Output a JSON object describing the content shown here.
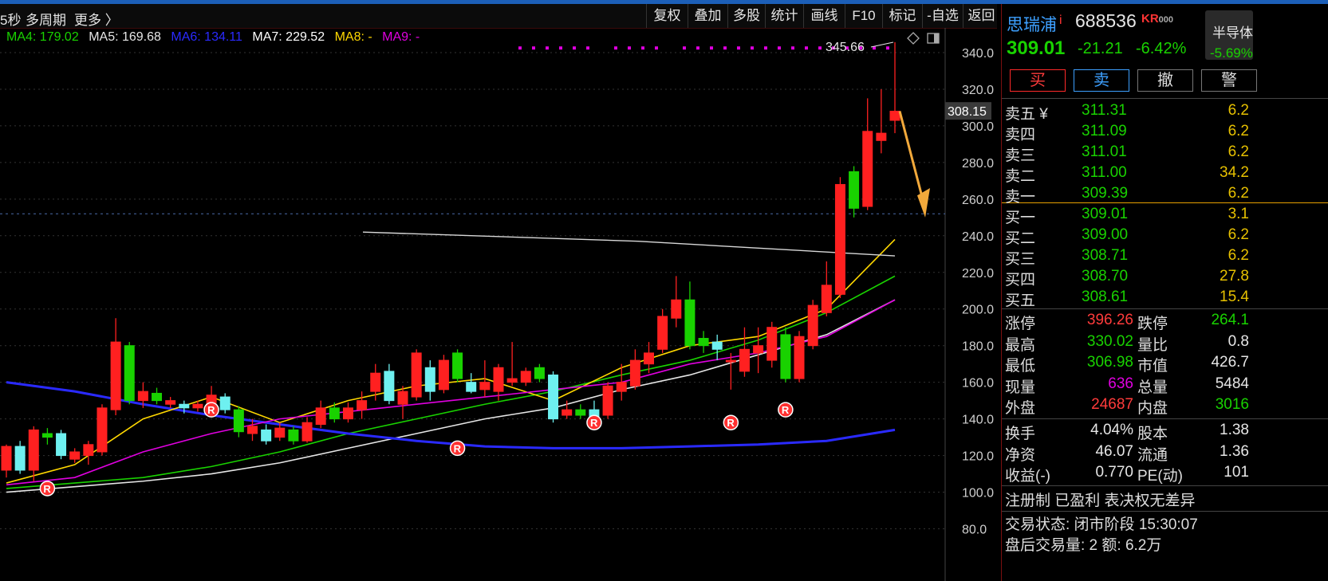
{
  "toolbar": {
    "left_frag": "5秒",
    "multi_period": "多周期",
    "more": "更多 〉",
    "buttons": [
      "复权",
      "叠加",
      "多股",
      "统计",
      "画线",
      "F10",
      "标记",
      "-自选",
      "返回"
    ]
  },
  "ma_legend": [
    {
      "label": "MA4: 179.02",
      "color": "#19d200"
    },
    {
      "label": "MA5: 169.68",
      "color": "#e6e6e6"
    },
    {
      "label": "MA6: 134.11",
      "color": "#2a2aff"
    },
    {
      "label": "MA7: 229.52",
      "color": "#ffffff"
    },
    {
      "label": "MA8: -",
      "color": "#ffd800"
    },
    {
      "label": "MA9: -",
      "color": "#e000e0"
    }
  ],
  "chart_icons": {
    "diamond": "diamond-icon",
    "window": "window-icon"
  },
  "chart_data": {
    "type": "candlestick",
    "ylim": [
      75,
      350
    ],
    "yticks": [
      "340.0",
      "320.0",
      "300.0",
      "280.0",
      "260.0",
      "240.0",
      "220.0",
      "200.0",
      "180.0",
      "160.0",
      "140.0",
      "120.0",
      "100.0",
      "80.0"
    ],
    "ytick_values": [
      340,
      320,
      300,
      280,
      260,
      240,
      220,
      200,
      180,
      160,
      140,
      120,
      100,
      80
    ],
    "current_price_label": "308.15",
    "current_price": 308.15,
    "high_annotation": "345.66",
    "high_value": 345.66,
    "dashed_level": 252,
    "flat_line": [
      242,
      229
    ],
    "candles": [
      [
        112,
        125,
        108,
        126,
        "up"
      ],
      [
        125,
        112,
        110,
        128,
        "down"
      ],
      [
        112,
        134,
        106,
        136,
        "up"
      ],
      [
        132,
        130,
        126,
        135,
        "down"
      ],
      [
        132,
        120,
        118,
        134,
        "down"
      ],
      [
        118,
        122,
        116,
        124,
        "up"
      ],
      [
        120,
        126,
        115,
        128,
        "up"
      ],
      [
        122,
        146,
        120,
        148,
        "up"
      ],
      [
        145,
        182,
        142,
        195,
        "up"
      ],
      [
        180,
        150,
        148,
        182,
        "down"
      ],
      [
        150,
        155,
        146,
        160,
        "up"
      ],
      [
        154,
        150,
        148,
        157,
        "down"
      ],
      [
        150,
        148,
        146,
        152,
        "up"
      ],
      [
        148,
        146,
        143,
        150,
        "down"
      ],
      [
        146,
        148,
        144,
        150,
        "up"
      ],
      [
        148,
        153,
        146,
        158,
        "up"
      ],
      [
        152,
        145,
        143,
        154,
        "down"
      ],
      [
        145,
        133,
        130,
        147,
        "down"
      ],
      [
        132,
        136,
        128,
        140,
        "up"
      ],
      [
        134,
        128,
        126,
        137,
        "down"
      ],
      [
        130,
        135,
        128,
        138,
        "up"
      ],
      [
        134,
        128,
        126,
        136,
        "down"
      ],
      [
        128,
        138,
        127,
        141,
        "up"
      ],
      [
        137,
        146,
        135,
        150,
        "up"
      ],
      [
        146,
        140,
        138,
        149,
        "down"
      ],
      [
        140,
        146,
        138,
        149,
        "up"
      ],
      [
        145,
        150,
        140,
        155,
        "up"
      ],
      [
        155,
        165,
        150,
        170,
        "up"
      ],
      [
        166,
        150,
        148,
        170,
        "down"
      ],
      [
        148,
        155,
        140,
        158,
        "up"
      ],
      [
        152,
        176,
        150,
        178,
        "up"
      ],
      [
        168,
        155,
        150,
        172,
        "down"
      ],
      [
        156,
        172,
        154,
        175,
        "up"
      ],
      [
        176,
        162,
        160,
        178,
        "down"
      ],
      [
        160,
        155,
        154,
        165,
        "down"
      ],
      [
        156,
        160,
        152,
        172,
        "up"
      ],
      [
        155,
        168,
        150,
        170,
        "up"
      ],
      [
        162,
        160,
        158,
        182,
        "up"
      ],
      [
        160,
        166,
        158,
        168,
        "up"
      ],
      [
        168,
        162,
        160,
        170,
        "down"
      ],
      [
        164,
        140,
        138,
        166,
        "down"
      ],
      [
        142,
        145,
        140,
        150,
        "up"
      ],
      [
        145,
        142,
        140,
        148,
        "down"
      ],
      [
        140,
        145,
        138,
        150,
        "down"
      ],
      [
        142,
        158,
        140,
        160,
        "up"
      ],
      [
        155,
        160,
        150,
        170,
        "up"
      ],
      [
        158,
        172,
        156,
        178,
        "up"
      ],
      [
        170,
        176,
        165,
        182,
        "up"
      ],
      [
        178,
        196,
        176,
        200,
        "up"
      ],
      [
        195,
        205,
        190,
        218,
        "up"
      ],
      [
        205,
        180,
        178,
        215,
        "down"
      ],
      [
        180,
        184,
        176,
        188,
        "down"
      ],
      [
        182,
        178,
        172,
        186,
        "down"
      ],
      [
        172,
        172,
        156,
        176,
        "up"
      ],
      [
        166,
        178,
        163,
        190,
        "up"
      ],
      [
        176,
        180,
        165,
        190,
        "up"
      ],
      [
        172,
        190,
        168,
        193,
        "up"
      ],
      [
        186,
        162,
        160,
        190,
        "down"
      ],
      [
        162,
        185,
        160,
        188,
        "up"
      ],
      [
        180,
        202,
        178,
        205,
        "up"
      ],
      [
        198,
        213,
        196,
        226,
        "up"
      ],
      [
        208,
        268,
        206,
        272,
        "up"
      ],
      [
        255,
        275,
        250,
        278,
        "down"
      ],
      [
        256,
        297,
        254,
        315,
        "up"
      ],
      [
        292,
        296,
        285,
        320,
        "up"
      ],
      [
        303,
        308,
        296,
        345.66,
        "up"
      ]
    ],
    "ma_lines": [
      {
        "name": "MA4",
        "color": "#19d200",
        "y": [
          102,
          105,
          108,
          114,
          122,
          132,
          140,
          148,
          155,
          164,
          172,
          183,
          198,
          218
        ]
      },
      {
        "name": "MA5",
        "color": "#e6e6e6",
        "y": [
          100,
          103,
          106,
          110,
          116,
          124,
          132,
          140,
          146,
          156,
          164,
          175,
          186,
          205
        ]
      },
      {
        "name": "MA6",
        "color": "#2a2aff",
        "y": [
          160,
          155,
          148,
          142,
          137,
          132,
          128,
          125,
          124,
          124,
          125,
          126,
          128,
          134
        ]
      },
      {
        "name": "MA8",
        "color": "#ffd800",
        "y": [
          105,
          115,
          140,
          152,
          138,
          150,
          158,
          162,
          150,
          168,
          180,
          185,
          200,
          238
        ]
      },
      {
        "name": "MA9",
        "color": "#e000e0",
        "y": [
          104,
          108,
          122,
          132,
          140,
          144,
          148,
          152,
          156,
          160,
          170,
          176,
          185,
          205
        ]
      }
    ],
    "r_markers": [
      {
        "i": 1,
        "v": 102
      },
      {
        "i": 7,
        "v": 145
      },
      {
        "i": 16,
        "v": 124
      },
      {
        "i": 21,
        "v": 138
      },
      {
        "i": 26,
        "v": 138
      },
      {
        "i": 28,
        "v": 145
      }
    ],
    "pink_dots": 28
  },
  "right_panel": {
    "name": "思瑞浦",
    "info_mark": "i",
    "code": "688536",
    "kr": "KR",
    "kr_small": "000",
    "sector": "半导体",
    "sector_pct": "-5.69%",
    "price": "309.01",
    "change": "-21.21",
    "change_pct": "-6.42%",
    "buy": "买",
    "sell": "卖",
    "cancel": "撤",
    "alert": "警",
    "asks": [
      {
        "label": "卖五 ¥",
        "price": "311.31",
        "vol": "6.2"
      },
      {
        "label": "卖四",
        "price": "311.09",
        "vol": "6.2"
      },
      {
        "label": "卖三",
        "price": "311.01",
        "vol": "6.2"
      },
      {
        "label": "卖二",
        "price": "311.00",
        "vol": "34.2"
      },
      {
        "label": "卖一",
        "price": "309.39",
        "vol": "6.2"
      }
    ],
    "bids": [
      {
        "label": "买一",
        "price": "309.01",
        "vol": "3.1"
      },
      {
        "label": "买二",
        "price": "309.00",
        "vol": "6.2"
      },
      {
        "label": "买三",
        "price": "308.71",
        "vol": "6.2"
      },
      {
        "label": "买四",
        "price": "308.70",
        "vol": "27.8"
      },
      {
        "label": "买五",
        "price": "308.61",
        "vol": "15.4"
      }
    ],
    "stats1": [
      {
        "l1": "涨停",
        "v1": "396.26",
        "c1": "#ff3b3b",
        "l2": "跌停",
        "v2": "264.1",
        "c2": "#19d200"
      },
      {
        "l1": "最高",
        "v1": "330.02",
        "c1": "#19d200",
        "l2": "量比",
        "v2": "0.8",
        "c2": "#e6e6e6"
      },
      {
        "l1": "最低",
        "v1": "306.98",
        "c1": "#19d200",
        "l2": "市值",
        "v2": "426.7",
        "c2": "#e6e6e6"
      },
      {
        "l1": "现量",
        "v1": "636",
        "c1": "#e000e0",
        "l2": "总量",
        "v2": "5484",
        "c2": "#e6e6e6"
      },
      {
        "l1": "外盘",
        "v1": "24687",
        "c1": "#ff3b3b",
        "l2": "内盘",
        "v2": "3016",
        "c2": "#19d200"
      }
    ],
    "stats2": [
      {
        "l1": "换手",
        "v1": "4.04%",
        "c1": "#e6e6e6",
        "l2": "股本",
        "v2": "1.38",
        "c2": "#e6e6e6"
      },
      {
        "l1": "净资",
        "v1": "46.07",
        "c1": "#e6e6e6",
        "l2": "流通",
        "v2": "1.36",
        "c2": "#e6e6e6"
      },
      {
        "l1": "收益(-)",
        "v1": "0.770",
        "c1": "#e6e6e6",
        "l2": "PE(动)",
        "v2": "101",
        "c2": "#e6e6e6"
      }
    ],
    "tags": "注册制 已盈利 表决权无差异",
    "trade_status": "交易状态: 闭市阶段 15:30:07",
    "after_hours": "盘后交易量: 2  额: 6.2万"
  },
  "colors": {
    "up": "#ff2020",
    "down": "#19d200",
    "cyan": "#6ef0f0",
    "bg": "#000000"
  }
}
